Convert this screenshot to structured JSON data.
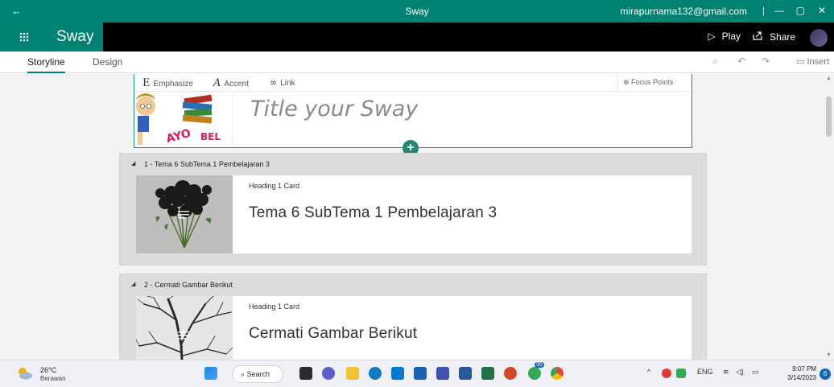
{
  "titlebar": {
    "back": "←",
    "title": "Sway",
    "account": "mirapurnama132@gmail.com",
    "separator": "|",
    "minimize": "—",
    "restore": "▢",
    "close": "✕"
  },
  "header": {
    "app_name": "Sway",
    "play_label": "Play",
    "share_label": "Share",
    "more": "···"
  },
  "tabs": {
    "storyline": "Storyline",
    "design": "Design",
    "insert": "Insert"
  },
  "title_card": {
    "emphasize": "Emphasize",
    "accent": "Accent",
    "link": "Link",
    "focus_points": "Focus Points",
    "placeholder": "Title your Sway",
    "add": "+"
  },
  "sections": [
    {
      "header": "1 - Tema 6 SubTema 1 Pembelajaran 3",
      "card_label": "Heading 1 Card",
      "card_title": "Tema 6 SubTema 1 Pembelajaran 3"
    },
    {
      "header": "2 - Cermati Gambar Berikut",
      "card_label": "Heading 1 Card",
      "card_title": "Cermati Gambar Berikut"
    }
  ],
  "taskbar": {
    "temperature": "26°C",
    "condition": "Berawan",
    "search": "Search",
    "language": "ENG",
    "time": "9:07 PM",
    "date": "3/14/2023",
    "notification_count": "6",
    "badge_count": "35"
  },
  "colors": {
    "brand": "#008272",
    "accent_green": "#1f8a6e",
    "header_black": "#000000",
    "canvas_bg": "#f2f2f2"
  }
}
